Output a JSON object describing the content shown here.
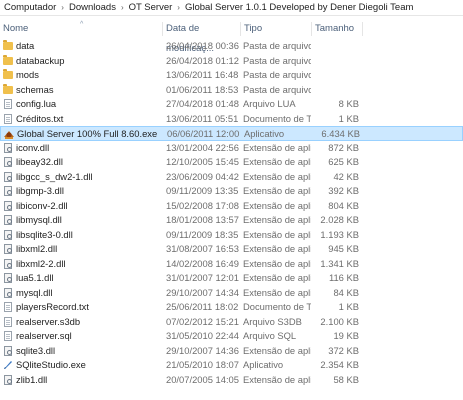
{
  "breadcrumb": [
    "Computador",
    "Downloads",
    "OT Server",
    "Global Server 1.0.1 Developed by Dener Diegoli Team"
  ],
  "breadcrumb_separator": "›",
  "columns": {
    "name": "Nome",
    "date": "Data de modificaç...",
    "type": "Tipo",
    "size": "Tamanho"
  },
  "sort_indicator": "^",
  "files": [
    {
      "name": "data",
      "date": "26/04/2018 00:36",
      "type": "Pasta de arquivos",
      "size": "",
      "icon": "folder-icon"
    },
    {
      "name": "databackup",
      "date": "26/04/2018 01:12",
      "type": "Pasta de arquivos",
      "size": "",
      "icon": "folder-icon"
    },
    {
      "name": "mods",
      "date": "13/06/2011 16:48",
      "type": "Pasta de arquivos",
      "size": "",
      "icon": "folder-icon"
    },
    {
      "name": "schemas",
      "date": "01/06/2011 18:53",
      "type": "Pasta de arquivos",
      "size": "",
      "icon": "folder-icon"
    },
    {
      "name": "config.lua",
      "date": "27/04/2018 01:48",
      "type": "Arquivo LUA",
      "size": "8 KB",
      "icon": "lua-file-icon"
    },
    {
      "name": "Créditos.txt",
      "date": "13/06/2011 05:51",
      "type": "Documento de Tex...",
      "size": "1 KB",
      "icon": "text-file-icon"
    },
    {
      "name": "Global Server 100% Full 8.60.exe",
      "date": "06/06/2011 12:00",
      "type": "Aplicativo",
      "size": "6.434 KB",
      "icon": "exe-icon",
      "selected": true
    },
    {
      "name": "iconv.dll",
      "date": "13/01/2004 22:56",
      "type": "Extensão de aplica...",
      "size": "872 KB",
      "icon": "dll-icon"
    },
    {
      "name": "libeay32.dll",
      "date": "12/10/2005 15:45",
      "type": "Extensão de aplica...",
      "size": "625 KB",
      "icon": "dll-icon"
    },
    {
      "name": "libgcc_s_dw2-1.dll",
      "date": "23/06/2009 04:42",
      "type": "Extensão de aplica...",
      "size": "42 KB",
      "icon": "dll-icon"
    },
    {
      "name": "libgmp-3.dll",
      "date": "09/11/2009 13:35",
      "type": "Extensão de aplica...",
      "size": "392 KB",
      "icon": "dll-icon"
    },
    {
      "name": "libiconv-2.dll",
      "date": "15/02/2008 17:08",
      "type": "Extensão de aplica...",
      "size": "804 KB",
      "icon": "dll-icon"
    },
    {
      "name": "libmysql.dll",
      "date": "18/01/2008 13:57",
      "type": "Extensão de aplica...",
      "size": "2.028 KB",
      "icon": "dll-icon"
    },
    {
      "name": "libsqlite3-0.dll",
      "date": "09/11/2009 18:35",
      "type": "Extensão de aplica...",
      "size": "1.193 KB",
      "icon": "dll-icon"
    },
    {
      "name": "libxml2.dll",
      "date": "31/08/2007 16:53",
      "type": "Extensão de aplica...",
      "size": "945 KB",
      "icon": "dll-icon"
    },
    {
      "name": "libxml2-2.dll",
      "date": "14/02/2008 16:49",
      "type": "Extensão de aplica...",
      "size": "1.341 KB",
      "icon": "dll-icon"
    },
    {
      "name": "lua5.1.dll",
      "date": "31/01/2007 12:01",
      "type": "Extensão de aplica...",
      "size": "116 KB",
      "icon": "dll-icon"
    },
    {
      "name": "mysql.dll",
      "date": "29/10/2007 14:34",
      "type": "Extensão de aplica...",
      "size": "84 KB",
      "icon": "dll-icon"
    },
    {
      "name": "playersRecord.txt",
      "date": "25/06/2011 18:02",
      "type": "Documento de Tex...",
      "size": "1 KB",
      "icon": "text-file-icon"
    },
    {
      "name": "realserver.s3db",
      "date": "07/02/2012 15:21",
      "type": "Arquivo S3DB",
      "size": "2.100 KB",
      "icon": "s3db-file-icon"
    },
    {
      "name": "realserver.sql",
      "date": "31/05/2010 22:44",
      "type": "Arquivo SQL",
      "size": "19 KB",
      "icon": "sql-file-icon"
    },
    {
      "name": "sqlite3.dll",
      "date": "29/10/2007 14:36",
      "type": "Extensão de aplica...",
      "size": "372 KB",
      "icon": "dll-icon"
    },
    {
      "name": "SQliteStudio.exe",
      "date": "21/05/2010 18:07",
      "type": "Aplicativo",
      "size": "2.354 KB",
      "icon": "sqlitestudio-icon"
    },
    {
      "name": "zlib1.dll",
      "date": "20/07/2005 14:05",
      "type": "Extensão de aplica...",
      "size": "58 KB",
      "icon": "dll-icon"
    }
  ]
}
